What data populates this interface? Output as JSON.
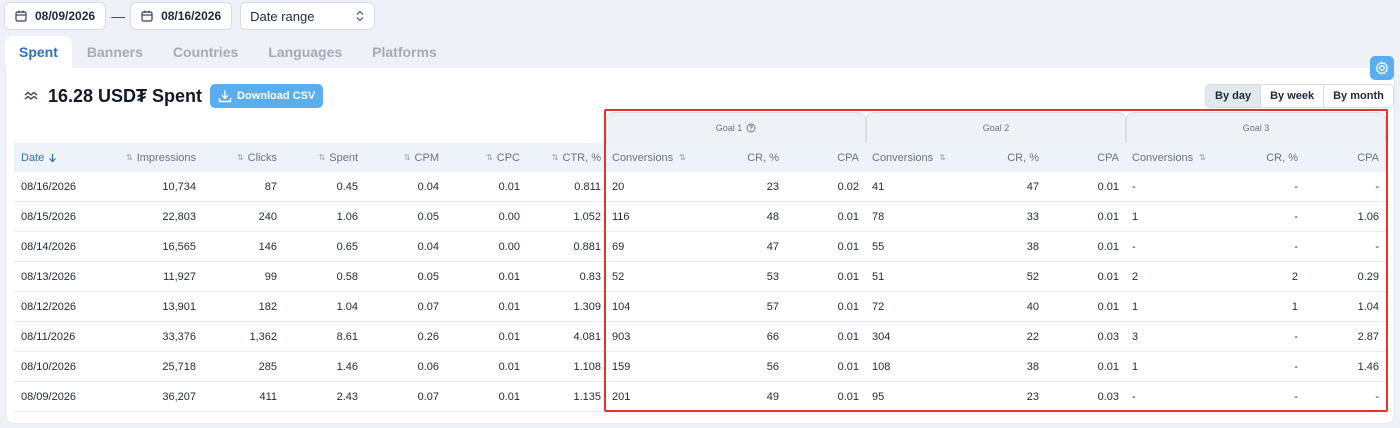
{
  "filters": {
    "date_from": "08/09/2026",
    "date_separator": "—",
    "date_to": "08/16/2026",
    "range_select": "Date range"
  },
  "tabs": [
    "Spent",
    "Banners",
    "Countries",
    "Languages",
    "Platforms"
  ],
  "active_tab": "Spent",
  "summary": {
    "title": "16.28 USD₮ Spent",
    "csv_label": "Download CSV"
  },
  "period": {
    "options": [
      "By day",
      "By week",
      "By month"
    ],
    "active": "By day"
  },
  "goals": [
    "Goal 1",
    "Goal 2",
    "Goal 3"
  ],
  "columns": {
    "date": "Date",
    "impressions": "Impressions",
    "clicks": "Clicks",
    "spent": "Spent",
    "cpm": "CPM",
    "cpc": "CPC",
    "ctr": "CTR, %",
    "conversions": "Conversions",
    "cr": "CR, %",
    "cpa": "CPA"
  },
  "rows": [
    {
      "date": "08/16/2026",
      "impressions": "10,734",
      "clicks": "87",
      "spent": "0.45",
      "cpm": "0.04",
      "cpc": "0.01",
      "ctr": "0.811",
      "g1_conv": "20",
      "g1_cr": "23",
      "g1_cpa": "0.02",
      "g2_conv": "41",
      "g2_cr": "47",
      "g2_cpa": "0.01",
      "g3_conv": "-",
      "g3_cr": "-",
      "g3_cpa": "-"
    },
    {
      "date": "08/15/2026",
      "impressions": "22,803",
      "clicks": "240",
      "spent": "1.06",
      "cpm": "0.05",
      "cpc": "0.00",
      "ctr": "1.052",
      "g1_conv": "116",
      "g1_cr": "48",
      "g1_cpa": "0.01",
      "g2_conv": "78",
      "g2_cr": "33",
      "g2_cpa": "0.01",
      "g3_conv": "1",
      "g3_cr": "-",
      "g3_cpa": "1.06"
    },
    {
      "date": "08/14/2026",
      "impressions": "16,565",
      "clicks": "146",
      "spent": "0.65",
      "cpm": "0.04",
      "cpc": "0.00",
      "ctr": "0.881",
      "g1_conv": "69",
      "g1_cr": "47",
      "g1_cpa": "0.01",
      "g2_conv": "55",
      "g2_cr": "38",
      "g2_cpa": "0.01",
      "g3_conv": "-",
      "g3_cr": "-",
      "g3_cpa": "-"
    },
    {
      "date": "08/13/2026",
      "impressions": "11,927",
      "clicks": "99",
      "spent": "0.58",
      "cpm": "0.05",
      "cpc": "0.01",
      "ctr": "0.83",
      "g1_conv": "52",
      "g1_cr": "53",
      "g1_cpa": "0.01",
      "g2_conv": "51",
      "g2_cr": "52",
      "g2_cpa": "0.01",
      "g3_conv": "2",
      "g3_cr": "2",
      "g3_cpa": "0.29"
    },
    {
      "date": "08/12/2026",
      "impressions": "13,901",
      "clicks": "182",
      "spent": "1.04",
      "cpm": "0.07",
      "cpc": "0.01",
      "ctr": "1.309",
      "g1_conv": "104",
      "g1_cr": "57",
      "g1_cpa": "0.01",
      "g2_conv": "72",
      "g2_cr": "40",
      "g2_cpa": "0.01",
      "g3_conv": "1",
      "g3_cr": "1",
      "g3_cpa": "1.04"
    },
    {
      "date": "08/11/2026",
      "impressions": "33,376",
      "clicks": "1,362",
      "spent": "8.61",
      "cpm": "0.26",
      "cpc": "0.01",
      "ctr": "4.081",
      "g1_conv": "903",
      "g1_cr": "66",
      "g1_cpa": "0.01",
      "g2_conv": "304",
      "g2_cr": "22",
      "g2_cpa": "0.03",
      "g3_conv": "3",
      "g3_cr": "-",
      "g3_cpa": "2.87"
    },
    {
      "date": "08/10/2026",
      "impressions": "25,718",
      "clicks": "285",
      "spent": "1.46",
      "cpm": "0.06",
      "cpc": "0.01",
      "ctr": "1.108",
      "g1_conv": "159",
      "g1_cr": "56",
      "g1_cpa": "0.01",
      "g2_conv": "108",
      "g2_cr": "38",
      "g2_cpa": "0.01",
      "g3_conv": "1",
      "g3_cr": "-",
      "g3_cpa": "1.46"
    },
    {
      "date": "08/09/2026",
      "impressions": "36,207",
      "clicks": "411",
      "spent": "2.43",
      "cpm": "0.07",
      "cpc": "0.01",
      "ctr": "1.135",
      "g1_conv": "201",
      "g1_cr": "49",
      "g1_cpa": "0.01",
      "g2_conv": "95",
      "g2_cr": "23",
      "g2_cpa": "0.03",
      "g3_conv": "-",
      "g3_cr": "-",
      "g3_cpa": "-"
    }
  ],
  "colors": {
    "accent": "#2f6fbf",
    "button": "#5aaef0",
    "highlight": "#e5322d"
  }
}
